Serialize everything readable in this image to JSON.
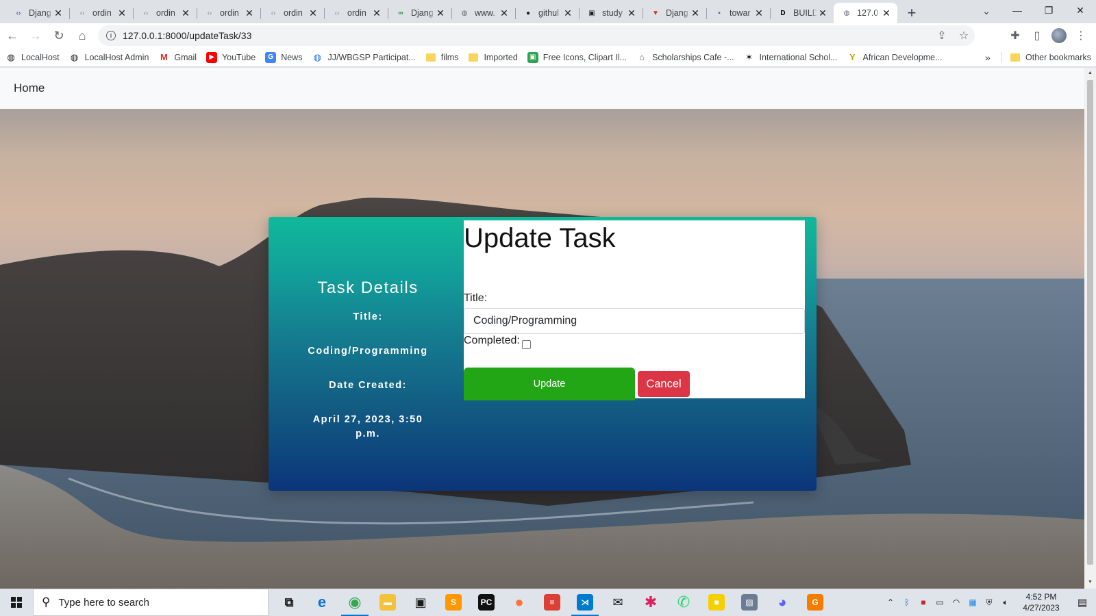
{
  "browser": {
    "tabs": [
      {
        "label": "Djang",
        "icon": "code-icon",
        "icon_color": "#7b4dd1"
      },
      {
        "label": "ordin",
        "icon": "code-icon",
        "icon_color": "#9aa0a6"
      },
      {
        "label": "ordin",
        "icon": "code-icon",
        "icon_color": "#9aa0a6"
      },
      {
        "label": "ordin",
        "icon": "code-icon",
        "icon_color": "#9aa0a6"
      },
      {
        "label": "ordin",
        "icon": "code-icon",
        "icon_color": "#9aa0a6"
      },
      {
        "label": "ordin",
        "icon": "code-icon",
        "icon_color": "#9aa0a6"
      },
      {
        "label": "Djang",
        "icon": "infinity-icon",
        "icon_color": "#1e8e3e"
      },
      {
        "label": "www.",
        "icon": "globe-icon",
        "icon_color": "#5f6368"
      },
      {
        "label": "githul",
        "icon": "github-icon",
        "icon_color": "#202124"
      },
      {
        "label": "study",
        "icon": "tablet-icon",
        "icon_color": "#202124"
      },
      {
        "label": "Djang",
        "icon": "v-icon",
        "icon_color": "#d93025"
      },
      {
        "label": "towar",
        "icon": "tds-icon",
        "icon_color": "#5f6368"
      },
      {
        "label": "BUILD",
        "icon": "dev-icon",
        "icon_color": "#000000"
      },
      {
        "label": "127.0",
        "icon": "globe-icon",
        "icon_color": "#5f6368",
        "active": true
      }
    ],
    "url": "127.0.0.1:8000/updateTask/33",
    "bookmarks": [
      {
        "label": "LocalHost",
        "icon": "globe-icon",
        "color": "#202124"
      },
      {
        "label": "LocalHost Admin",
        "icon": "globe-icon",
        "color": "#202124"
      },
      {
        "label": "Gmail",
        "icon": "gmail-icon",
        "color": "#d93025"
      },
      {
        "label": "YouTube",
        "icon": "youtube-icon",
        "color": "#ff0000"
      },
      {
        "label": "News",
        "icon": "news-icon",
        "color": "#4285f4"
      },
      {
        "label": "JJ/WBGSP Participat...",
        "icon": "globe-icon",
        "color": "#1a73e8"
      },
      {
        "label": "films",
        "icon": "folder-icon",
        "color": "#f9d55b"
      },
      {
        "label": "Imported",
        "icon": "folder-icon",
        "color": "#f9d55b"
      },
      {
        "label": "Free Icons, Clipart Il...",
        "icon": "icons-icon",
        "color": "#2ea44f"
      },
      {
        "label": "Scholarships Cafe -...",
        "icon": "cap-icon",
        "color": "#5f6368"
      },
      {
        "label": "International Schol...",
        "icon": "bird-icon",
        "color": "#202124"
      },
      {
        "label": "African Developme...",
        "icon": "afdb-icon",
        "color": "#c0a000"
      }
    ],
    "other_bookmarks": "Other bookmarks"
  },
  "page": {
    "nav_home": "Home",
    "details": {
      "heading": "Task Details",
      "title_label": "Title:",
      "title_value": "Coding/Programming",
      "date_label": "Date Created:",
      "date_value": "April 27, 2023, 3:50 p.m."
    },
    "form": {
      "heading": "Update Task",
      "title_label": "Title:",
      "title_value": "Coding/Programming",
      "completed_label": "Completed:",
      "completed_checked": false,
      "update_label": "Update",
      "cancel_label": "Cancel"
    }
  },
  "taskbar": {
    "search_placeholder": "Type here to search",
    "apps": [
      {
        "name": "task-view-icon",
        "color": "#1b1b1b"
      },
      {
        "name": "edge-icon",
        "color": "#0c74d5"
      },
      {
        "name": "chrome-icon",
        "color": "#34a853",
        "running": true
      },
      {
        "name": "file-explorer-icon",
        "color": "#f3c13a"
      },
      {
        "name": "store-icon",
        "color": "#1b1b1b"
      },
      {
        "name": "sublime-icon",
        "color": "#ff9800"
      },
      {
        "name": "pycharm-icon",
        "color": "#111111"
      },
      {
        "name": "firefox-icon",
        "color": "#ff7139"
      },
      {
        "name": "todoist-icon",
        "color": "#db4035"
      },
      {
        "name": "vscode-icon",
        "color": "#007acc",
        "running": true
      },
      {
        "name": "mail-icon",
        "color": "#1b1b1b"
      },
      {
        "name": "slack-icon",
        "color": "#e01e5a"
      },
      {
        "name": "whatsapp-icon",
        "color": "#25d366"
      },
      {
        "name": "sticky-icon",
        "color": "#f5d000"
      },
      {
        "name": "photos-icon",
        "color": "#6b7c93"
      },
      {
        "name": "discord-icon",
        "color": "#5865f2"
      },
      {
        "name": "pdf-icon",
        "color": "#f57c00"
      }
    ],
    "time": "4:52 PM",
    "date": "4/27/2023"
  }
}
